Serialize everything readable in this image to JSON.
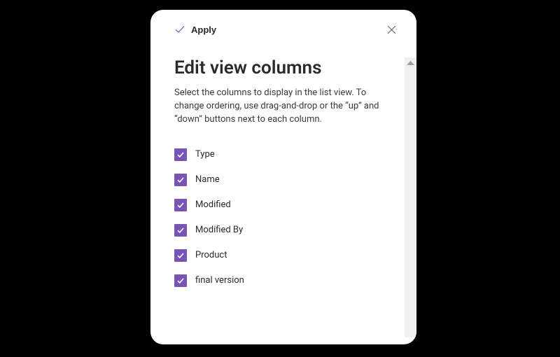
{
  "colors": {
    "accent": "#7855b5",
    "text": "#2a2a2a",
    "muted": "#5a5a5a",
    "scrollbar_arrow": "#9e9e9e",
    "scrollbar_track": "#f0f0f0"
  },
  "header": {
    "apply_label": "Apply",
    "icons": {
      "apply": "check-icon",
      "close": "close-icon"
    }
  },
  "title": "Edit view columns",
  "description": "Select the columns to display in the list view. To change ordering, use drag-and-drop or the “up” and “down” buttons next to each column.",
  "columns": [
    {
      "label": "Type",
      "checked": true
    },
    {
      "label": "Name",
      "checked": true
    },
    {
      "label": "Modified",
      "checked": true
    },
    {
      "label": "Modified By",
      "checked": true
    },
    {
      "label": "Product",
      "checked": true
    },
    {
      "label": "final version",
      "checked": true
    }
  ]
}
